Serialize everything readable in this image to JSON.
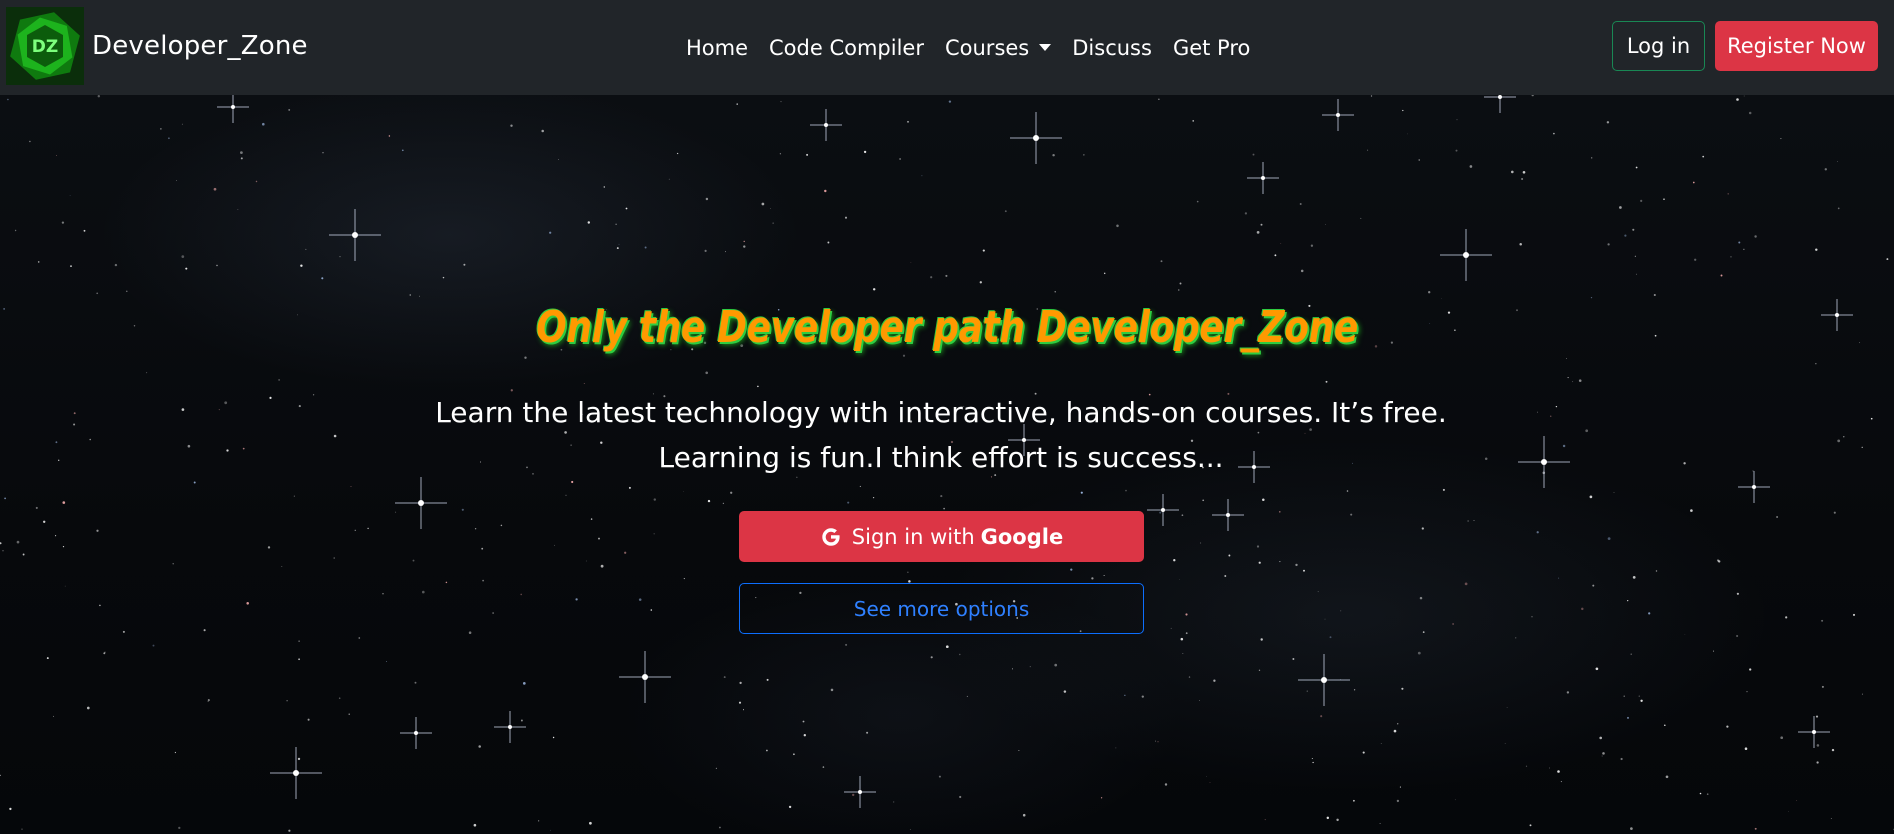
{
  "brand": {
    "logo_text": "DZ",
    "name": "Developer_Zone",
    "logo_color": "#1db31d"
  },
  "nav": {
    "items": [
      {
        "label": "Home"
      },
      {
        "label": "Code Compiler"
      },
      {
        "label": "Courses"
      },
      {
        "label": "Discuss"
      },
      {
        "label": "Get Pro"
      }
    ],
    "login_label": "Log in",
    "register_label": "Register Now"
  },
  "hero": {
    "title": "Only the Developer path Developer_Zone",
    "description": "Learn the latest technology with interactive, hands-on courses. It’s free. Learning is fun.I think effort is success...",
    "google_prefix": "Sign in with",
    "google_brand": "Google",
    "more_options_label": "See more options"
  },
  "colors": {
    "navbar_bg": "#212529",
    "accent_red": "#dc3545",
    "accent_green": "#198754",
    "accent_blue": "#0d6efd",
    "title_orange": "#ff9900",
    "title_glow": "#2ecc40"
  },
  "icons": {
    "caret": "chevron-down-icon",
    "google": "google-icon"
  }
}
